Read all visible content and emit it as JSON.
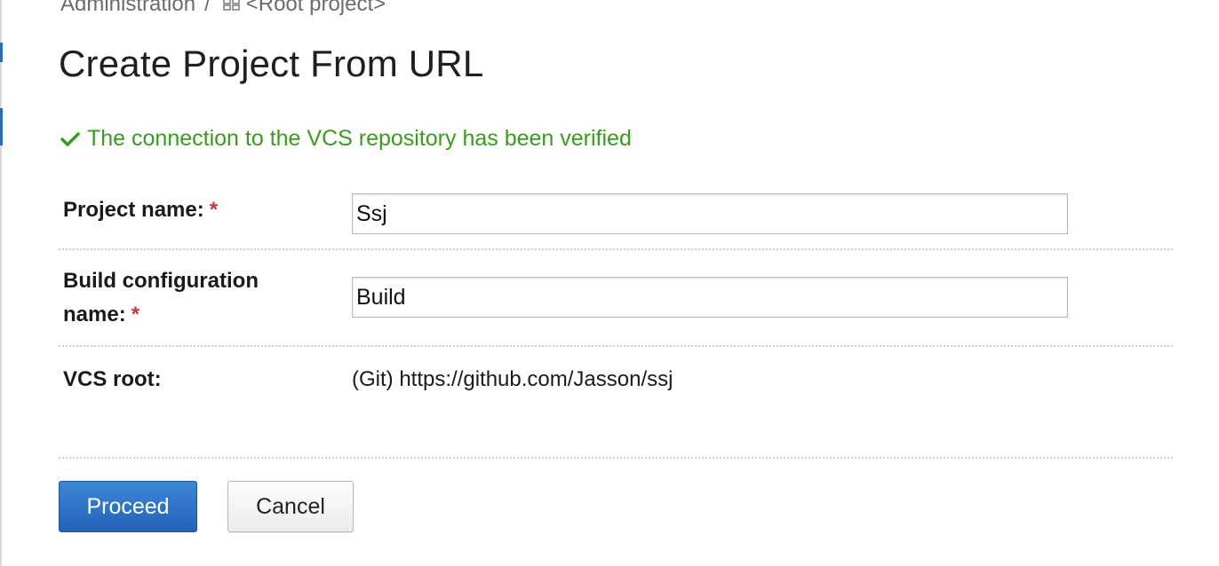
{
  "breadcrumb": {
    "items": [
      "Administration",
      "<Root project>"
    ],
    "separator": "/",
    "project_icon": "grid-icon"
  },
  "page": {
    "title": "Create Project From URL"
  },
  "status": {
    "icon": "checkmark-icon",
    "message": "The connection to the VCS repository has been verified",
    "color": "#3a9b1e"
  },
  "form": {
    "required_marker": "*",
    "project_name": {
      "label": "Project name:",
      "value": "Ssj"
    },
    "build_config_name": {
      "label_line1": "Build configuration",
      "label_line2": "name:",
      "value": "Build"
    },
    "vcs_root": {
      "label": "VCS root:",
      "value": "(Git) https://github.com/Jasson/ssj"
    }
  },
  "actions": {
    "proceed_label": "Proceed",
    "cancel_label": "Cancel"
  },
  "colors": {
    "primary": "#2f74c8",
    "required": "#d0343a",
    "success": "#3a9b1e"
  }
}
